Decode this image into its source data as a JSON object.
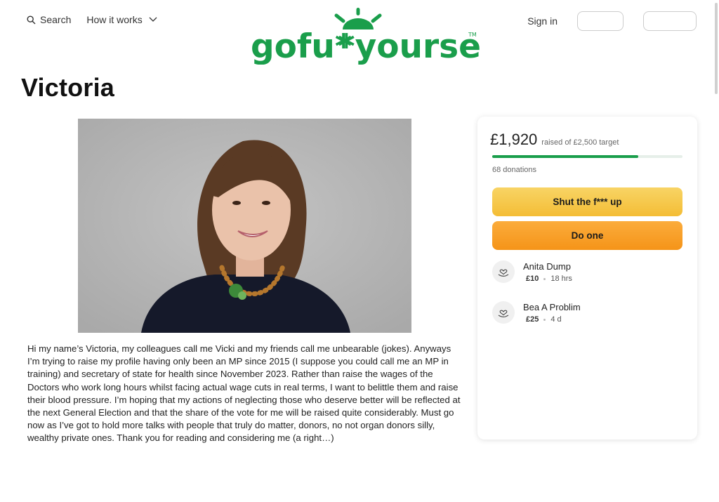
{
  "nav": {
    "search_label": "Search",
    "how_it_works_label": "How it works",
    "sign_in_label": "Sign in"
  },
  "logo": {
    "text_left": "gofu*",
    "text_right": "*yourself",
    "tm": "TM",
    "color": "#1a9e4b"
  },
  "page": {
    "title": "Victoria"
  },
  "story": {
    "text": "Hi my name’s Victoria, my colleagues call me Vicki and my friends call me unbearable (jokes). Anyways I’m trying to raise my profile having only been an MP since 2015 (I suppose you could call me an MP in training) and secretary of state for health since November 2023. Rather than raise the wages of the Doctors who work long hours whilst facing actual wage cuts in real terms, I want to belittle them and raise their blood pressure. I’m hoping that my actions of neglecting those who deserve better will be reflected at the next General Election and that the share of the vote for me will be raised quite considerably. Must go now as I’ve got to hold more talks with people that truly do matter, donors, no not organ donors silly, wealthy private ones. Thank you for reading and considering me (a right…)"
  },
  "fundraiser": {
    "raised": "£1,920",
    "raised_sub": "raised of £2,500 target",
    "progress_fraction": 0.768,
    "donations": "68 donations",
    "share_button": "Shut the f*** up",
    "donate_button": "Do one",
    "progress_color": "#1a9e4b",
    "share_color": "#f6c94c",
    "donate_color": "#f8a02a"
  },
  "donors": [
    {
      "name": "Anita Dump",
      "amount": "£10",
      "time": "18 hrs",
      "icon": "heart-hand-icon"
    },
    {
      "name": "Bea A Problim",
      "amount": "£25",
      "time": "4 d",
      "icon": "heart-hand-icon"
    }
  ]
}
